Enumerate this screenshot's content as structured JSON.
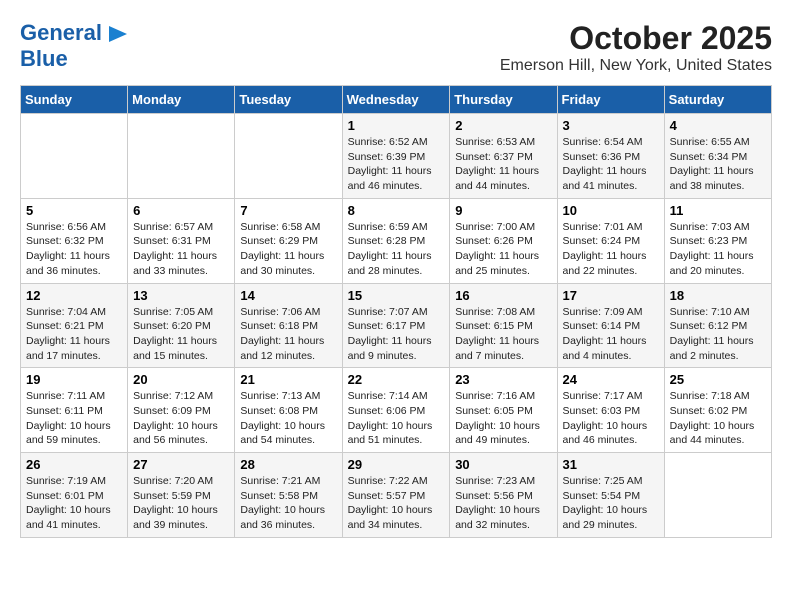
{
  "header": {
    "logo_line1": "General",
    "logo_line2": "Blue",
    "title": "October 2025",
    "subtitle": "Emerson Hill, New York, United States"
  },
  "days_of_week": [
    "Sunday",
    "Monday",
    "Tuesday",
    "Wednesday",
    "Thursday",
    "Friday",
    "Saturday"
  ],
  "weeks": [
    [
      {
        "day": "",
        "content": ""
      },
      {
        "day": "",
        "content": ""
      },
      {
        "day": "",
        "content": ""
      },
      {
        "day": "1",
        "content": "Sunrise: 6:52 AM\nSunset: 6:39 PM\nDaylight: 11 hours and 46 minutes."
      },
      {
        "day": "2",
        "content": "Sunrise: 6:53 AM\nSunset: 6:37 PM\nDaylight: 11 hours and 44 minutes."
      },
      {
        "day": "3",
        "content": "Sunrise: 6:54 AM\nSunset: 6:36 PM\nDaylight: 11 hours and 41 minutes."
      },
      {
        "day": "4",
        "content": "Sunrise: 6:55 AM\nSunset: 6:34 PM\nDaylight: 11 hours and 38 minutes."
      }
    ],
    [
      {
        "day": "5",
        "content": "Sunrise: 6:56 AM\nSunset: 6:32 PM\nDaylight: 11 hours and 36 minutes."
      },
      {
        "day": "6",
        "content": "Sunrise: 6:57 AM\nSunset: 6:31 PM\nDaylight: 11 hours and 33 minutes."
      },
      {
        "day": "7",
        "content": "Sunrise: 6:58 AM\nSunset: 6:29 PM\nDaylight: 11 hours and 30 minutes."
      },
      {
        "day": "8",
        "content": "Sunrise: 6:59 AM\nSunset: 6:28 PM\nDaylight: 11 hours and 28 minutes."
      },
      {
        "day": "9",
        "content": "Sunrise: 7:00 AM\nSunset: 6:26 PM\nDaylight: 11 hours and 25 minutes."
      },
      {
        "day": "10",
        "content": "Sunrise: 7:01 AM\nSunset: 6:24 PM\nDaylight: 11 hours and 22 minutes."
      },
      {
        "day": "11",
        "content": "Sunrise: 7:03 AM\nSunset: 6:23 PM\nDaylight: 11 hours and 20 minutes."
      }
    ],
    [
      {
        "day": "12",
        "content": "Sunrise: 7:04 AM\nSunset: 6:21 PM\nDaylight: 11 hours and 17 minutes."
      },
      {
        "day": "13",
        "content": "Sunrise: 7:05 AM\nSunset: 6:20 PM\nDaylight: 11 hours and 15 minutes."
      },
      {
        "day": "14",
        "content": "Sunrise: 7:06 AM\nSunset: 6:18 PM\nDaylight: 11 hours and 12 minutes."
      },
      {
        "day": "15",
        "content": "Sunrise: 7:07 AM\nSunset: 6:17 PM\nDaylight: 11 hours and 9 minutes."
      },
      {
        "day": "16",
        "content": "Sunrise: 7:08 AM\nSunset: 6:15 PM\nDaylight: 11 hours and 7 minutes."
      },
      {
        "day": "17",
        "content": "Sunrise: 7:09 AM\nSunset: 6:14 PM\nDaylight: 11 hours and 4 minutes."
      },
      {
        "day": "18",
        "content": "Sunrise: 7:10 AM\nSunset: 6:12 PM\nDaylight: 11 hours and 2 minutes."
      }
    ],
    [
      {
        "day": "19",
        "content": "Sunrise: 7:11 AM\nSunset: 6:11 PM\nDaylight: 10 hours and 59 minutes."
      },
      {
        "day": "20",
        "content": "Sunrise: 7:12 AM\nSunset: 6:09 PM\nDaylight: 10 hours and 56 minutes."
      },
      {
        "day": "21",
        "content": "Sunrise: 7:13 AM\nSunset: 6:08 PM\nDaylight: 10 hours and 54 minutes."
      },
      {
        "day": "22",
        "content": "Sunrise: 7:14 AM\nSunset: 6:06 PM\nDaylight: 10 hours and 51 minutes."
      },
      {
        "day": "23",
        "content": "Sunrise: 7:16 AM\nSunset: 6:05 PM\nDaylight: 10 hours and 49 minutes."
      },
      {
        "day": "24",
        "content": "Sunrise: 7:17 AM\nSunset: 6:03 PM\nDaylight: 10 hours and 46 minutes."
      },
      {
        "day": "25",
        "content": "Sunrise: 7:18 AM\nSunset: 6:02 PM\nDaylight: 10 hours and 44 minutes."
      }
    ],
    [
      {
        "day": "26",
        "content": "Sunrise: 7:19 AM\nSunset: 6:01 PM\nDaylight: 10 hours and 41 minutes."
      },
      {
        "day": "27",
        "content": "Sunrise: 7:20 AM\nSunset: 5:59 PM\nDaylight: 10 hours and 39 minutes."
      },
      {
        "day": "28",
        "content": "Sunrise: 7:21 AM\nSunset: 5:58 PM\nDaylight: 10 hours and 36 minutes."
      },
      {
        "day": "29",
        "content": "Sunrise: 7:22 AM\nSunset: 5:57 PM\nDaylight: 10 hours and 34 minutes."
      },
      {
        "day": "30",
        "content": "Sunrise: 7:23 AM\nSunset: 5:56 PM\nDaylight: 10 hours and 32 minutes."
      },
      {
        "day": "31",
        "content": "Sunrise: 7:25 AM\nSunset: 5:54 PM\nDaylight: 10 hours and 29 minutes."
      },
      {
        "day": "",
        "content": ""
      }
    ]
  ]
}
